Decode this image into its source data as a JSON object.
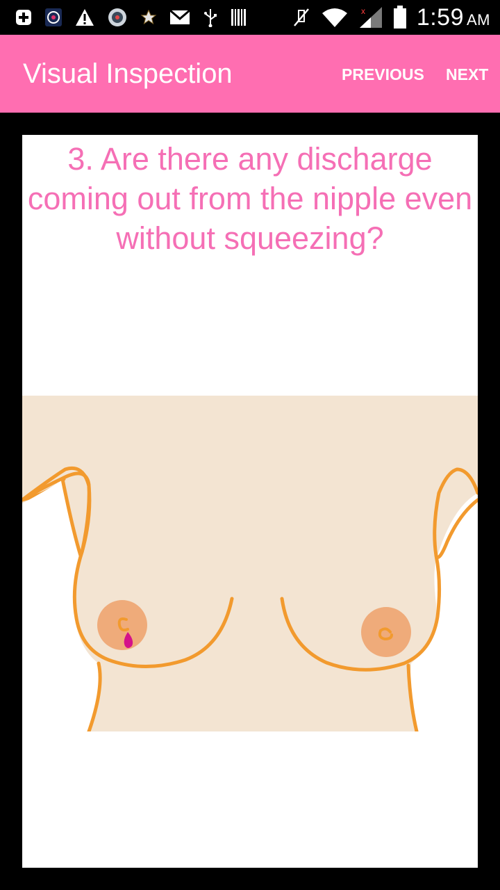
{
  "status_bar": {
    "time": "1:59",
    "ampm": "AM",
    "icons": [
      "plus-icon",
      "app-icon",
      "warning-icon",
      "vpn-icon",
      "star-icon",
      "gmail-icon",
      "usb-icon",
      "barcode-icon",
      "mute-icon",
      "wifi-icon",
      "signal-icon",
      "battery-icon"
    ]
  },
  "app_bar": {
    "title": "Visual Inspection",
    "previous_label": "PREVIOUS",
    "next_label": "NEXT",
    "color": "#ff6eb1"
  },
  "content": {
    "question": "3. Are there any discharge coming out from the nipple even without squeezing?",
    "question_color": "#f56fb5",
    "illustration": {
      "skin_color": "#f3e4d2",
      "outline_color": "#f29a2e",
      "areola_color": "#efab7a",
      "discharge_color": "#d4128a"
    }
  }
}
